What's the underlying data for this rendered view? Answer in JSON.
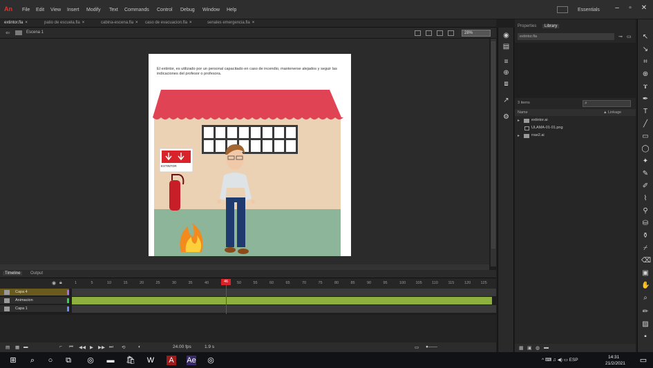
{
  "app": {
    "logo": "An",
    "menu": [
      "File",
      "Edit",
      "View",
      "Insert",
      "Modify",
      "Text",
      "Commands",
      "Control",
      "Debug",
      "Window",
      "Help"
    ],
    "workspace": "Essentials",
    "window_controls": [
      "–",
      "▫",
      "✕"
    ]
  },
  "doc_tabs": [
    {
      "label": "extintor.fla",
      "active": true
    },
    {
      "label": "patio de escuela.fla",
      "active": false
    },
    {
      "label": "cabina-escena.fla",
      "active": false
    },
    {
      "label": "caso de evacuacion.fla",
      "active": false
    },
    {
      "label": "senales emergencia.fla",
      "active": false
    }
  ],
  "editbar": {
    "scene": "Escena 1",
    "zoom": "28%"
  },
  "stage": {
    "caption": "El extintor, es utilizado por un personal capacitado en caso de incendio, mantenerse alejados y seguir las indicaciones del profesor o profesora.",
    "sign_text": "EXTINTOR",
    "colors": {
      "roof": "#e04354",
      "wall": "#ecd2b4",
      "floor": "#8db59a"
    }
  },
  "library": {
    "tabs": [
      {
        "label": "Properties",
        "active": false
      },
      {
        "label": "Library",
        "active": true
      }
    ],
    "doc": "extintor.fla",
    "count": "3 items",
    "col_name": "Name",
    "col_linkage": "▲ Linkage",
    "items": [
      {
        "type": "folder",
        "label": "extintor.ai"
      },
      {
        "type": "bitmap",
        "label": "ULAMA-01-01.png"
      },
      {
        "type": "folder",
        "label": "rrae2.ai"
      }
    ]
  },
  "timeline": {
    "tabs": [
      {
        "label": "Timeline",
        "active": true
      },
      {
        "label": "Output",
        "active": false
      }
    ],
    "ticks": [
      "1",
      "5",
      "10",
      "15",
      "20",
      "25",
      "30",
      "35",
      "40",
      "45",
      "50",
      "55",
      "60",
      "65",
      "70",
      "75",
      "80",
      "85",
      "90",
      "95",
      "100",
      "105",
      "110",
      "115",
      "120",
      "125"
    ],
    "current_frame": "46",
    "layers": [
      {
        "name": "Capa 4",
        "active": true,
        "color": "#a86df0"
      },
      {
        "name": "Animacion",
        "active": false,
        "color": "#3bd04a"
      },
      {
        "name": "Capa 1",
        "active": false,
        "color": "#6a8ff0"
      }
    ],
    "footer_fps": "24.00 fps",
    "footer_time": "1.9 s"
  },
  "taskbar": {
    "tray": "^ ⌨ ♫ ◀) ▭ ESP",
    "time": "14:31",
    "date": "21/2/2021"
  }
}
